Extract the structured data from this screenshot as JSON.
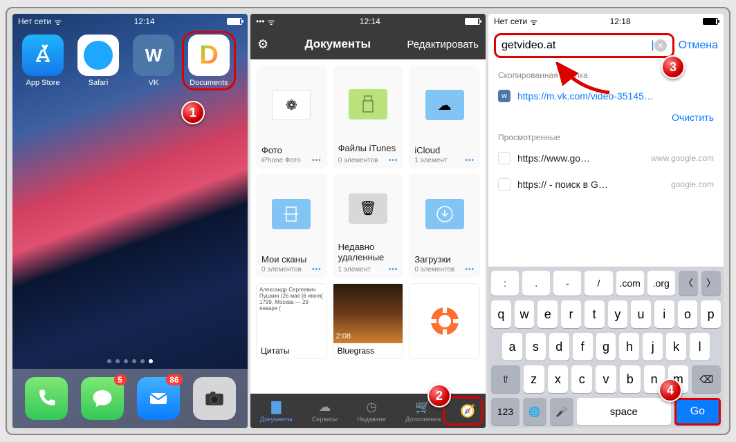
{
  "screen1": {
    "status": {
      "carrier": "Нет сети",
      "time": "12:14"
    },
    "apps": [
      {
        "label": "App Store"
      },
      {
        "label": "Safari"
      },
      {
        "label": "VK"
      },
      {
        "label": "Documents"
      }
    ],
    "badges": {
      "messages": "5",
      "mail": "86"
    }
  },
  "screen2": {
    "status": {
      "time": "12:14"
    },
    "nav": {
      "title": "Документы",
      "edit": "Редактировать"
    },
    "folders": [
      {
        "name": "Фото",
        "sub": "iPhone Фото"
      },
      {
        "name": "Файлы iTunes",
        "sub": "0 элементов"
      },
      {
        "name": "iCloud",
        "sub": "1 элемент"
      },
      {
        "name": "Мои сканы",
        "sub": "0 элементов"
      },
      {
        "name": "Недавно удаленные",
        "sub": "1 элемент"
      },
      {
        "name": "Загрузки",
        "sub": "0 элементов"
      }
    ],
    "bottomRow": [
      {
        "name": "Цитаты",
        "preview": "Александр Сергеевич Пушкин (26 мая [6 июня] 1799, Москва — 29 января ("
      },
      {
        "name": "Bluegrass",
        "preview": "2:08"
      }
    ],
    "tabs": [
      "Документы",
      "Сервисы",
      "Недавние",
      "Дополнения",
      ""
    ]
  },
  "screen3": {
    "status": {
      "carrier": "Нет сети",
      "time": "12:18"
    },
    "search": {
      "value": "getvideo.at",
      "cancel": "Отмена"
    },
    "copiedLabel": "Скопированная ссылка",
    "copiedLink": "https://m.vk.com/video-35145…",
    "viewedLabel": "Просмотренные",
    "clearLabel": "Очистить",
    "history": [
      {
        "primary": "https://www.go…",
        "secondary": "www.google.com"
      },
      {
        "primary": "https:// - поиск в G…",
        "secondary": "google.com"
      }
    ],
    "keyboard": {
      "top": [
        ":",
        ".",
        "-",
        "/",
        ".com",
        ".org"
      ],
      "r1": [
        "q",
        "w",
        "e",
        "r",
        "t",
        "y",
        "u",
        "i",
        "o",
        "p"
      ],
      "r2": [
        "a",
        "s",
        "d",
        "f",
        "g",
        "h",
        "j",
        "k",
        "l"
      ],
      "r3": [
        "z",
        "x",
        "c",
        "v",
        "b",
        "n",
        "m"
      ],
      "num": "123",
      "space": "space",
      "go": "Go"
    }
  }
}
